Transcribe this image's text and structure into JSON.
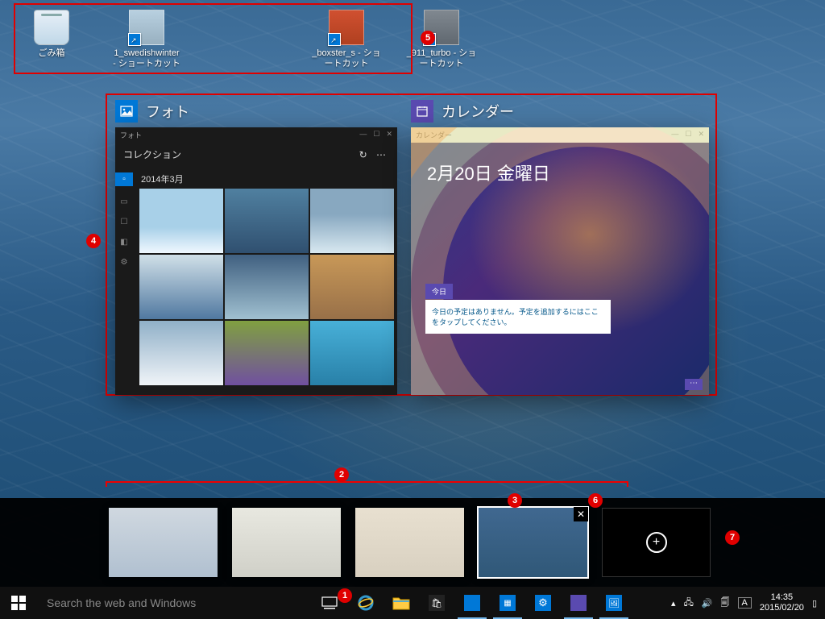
{
  "desktop": {
    "icons": [
      {
        "name": "recycle-bin",
        "label": "ごみ箱"
      },
      {
        "name": "shortcut-winter",
        "label": "1_swedishwinter - ショートカット"
      },
      {
        "name": "shortcut-boxster",
        "label": "_boxster_s - ショートカット"
      },
      {
        "name": "shortcut-911",
        "label": "_911_turbo - ショートカット"
      }
    ]
  },
  "annotations": {
    "1": "1",
    "2": "2",
    "3": "3",
    "4": "4",
    "5": "5",
    "6": "6",
    "7": "7"
  },
  "taskview": {
    "photos": {
      "title": "フォト",
      "window_title": "フォト",
      "subtitle": "コレクション",
      "date_header": "2014年3月"
    },
    "calendar": {
      "title": "カレンダー",
      "window_title": "カレンダー",
      "date": "2月20日 金曜日",
      "today": "今日",
      "message": "今日の予定はありません。予定を追加するにはここをタップしてください。"
    }
  },
  "virtual_desktops": {
    "count": 4,
    "selected": 3
  },
  "taskbar": {
    "search_placeholder": "Search the web and Windows",
    "ime": "A"
  },
  "clock": {
    "time": "14:35",
    "date": "2015/02/20"
  },
  "winctl": {
    "min": "—",
    "max": "☐",
    "close": "✕"
  }
}
